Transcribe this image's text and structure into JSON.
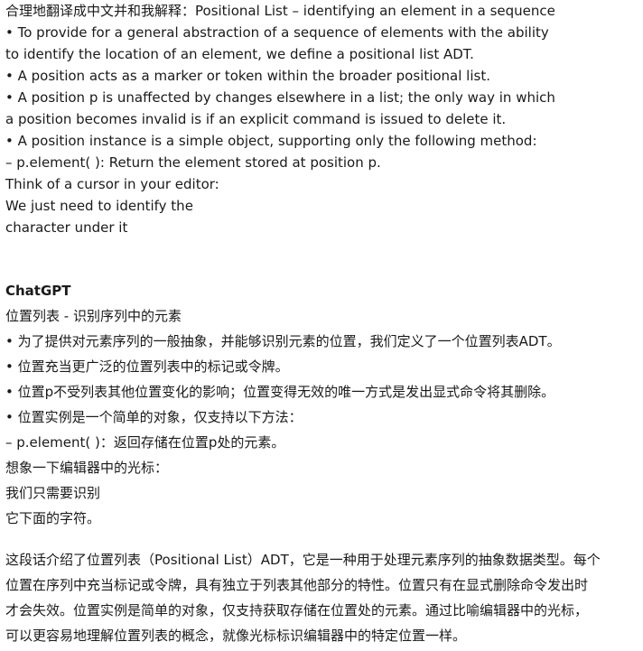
{
  "user_message": {
    "lines": [
      "合理地翻译成中文并和我解释：Positional List – identifying an element in a sequence",
      "• To provide for a general abstraction of a sequence of elements with the ability",
      "to identify the location of an element, we define a positional list ADT.",
      "• A position acts as a marker or token within the broader positional list.",
      "• A position p is unaffected by changes elsewhere in a list; the only way in which",
      "a position becomes invalid is if an explicit command is issued to delete it.",
      "• A position instance is a simple object, supporting only the following method:",
      "– p.element( ): Return the element stored at position p.",
      "Think of a cursor in your editor:",
      "We just need to identify the",
      "character under it"
    ]
  },
  "assistant": {
    "name": "ChatGPT",
    "lines": [
      "位置列表 - 识别序列中的元素",
      "• 为了提供对元素序列的一般抽象，并能够识别元素的位置，我们定义了一个位置列表ADT。",
      "• 位置充当更广泛的位置列表中的标记或令牌。",
      "• 位置p不受列表其他位置变化的影响；位置变得无效的唯一方式是发出显式命令将其删除。",
      "• 位置实例是一个简单的对象，仅支持以下方法：",
      "– p.element( )：返回存储在位置p处的元素。",
      "想象一下编辑器中的光标：",
      "我们只需要识别",
      "它下面的字符。"
    ],
    "paragraph_lines": [
      "这段话介绍了位置列表（Positional List）ADT，它是一种用于处理元素序列的抽象数据类型。每个",
      "位置在序列中充当标记或令牌，具有独立于列表其他部分的特性。位置只有在显式删除命令发出时",
      "才会失效。位置实例是简单的对象，仅支持获取存储在位置处的元素。通过比喻编辑器中的光标，",
      "可以更容易地理解位置列表的概念，就像光标标识编辑器中的特定位置一样。"
    ]
  }
}
